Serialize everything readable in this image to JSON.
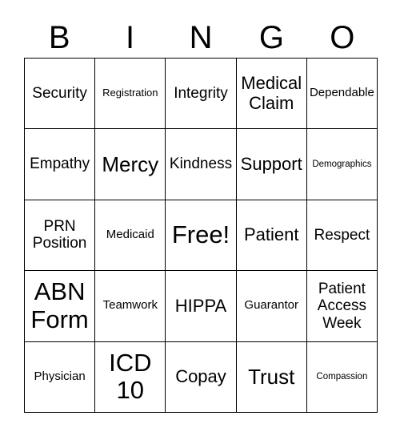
{
  "card": {
    "title_letters": [
      "B",
      "I",
      "N",
      "G",
      "O"
    ],
    "grid": {
      "rows": 5,
      "columns": 5,
      "cells": [
        {
          "text": "Security",
          "size": "md"
        },
        {
          "text": "Registration",
          "size": "xs"
        },
        {
          "text": "Integrity",
          "size": "md"
        },
        {
          "text": "Medical Claim",
          "size": "lg"
        },
        {
          "text": "Dependable",
          "size": "sm"
        },
        {
          "text": "Empathy",
          "size": "md"
        },
        {
          "text": "Mercy",
          "size": "xl"
        },
        {
          "text": "Kindness",
          "size": "md"
        },
        {
          "text": "Support",
          "size": "lg"
        },
        {
          "text": "Demographics",
          "size": "xxs"
        },
        {
          "text": "PRN Position",
          "size": "md"
        },
        {
          "text": "Medicaid",
          "size": "sm"
        },
        {
          "text": "Free!",
          "size": "xxl"
        },
        {
          "text": "Patient",
          "size": "lg"
        },
        {
          "text": "Respect",
          "size": "md"
        },
        {
          "text": "ABN Form",
          "size": "xxl"
        },
        {
          "text": "Teamwork",
          "size": "sm"
        },
        {
          "text": "HIPPA",
          "size": "lg"
        },
        {
          "text": "Guarantor",
          "size": "sm"
        },
        {
          "text": "Patient Access Week",
          "size": "md"
        },
        {
          "text": "Physician",
          "size": "sm"
        },
        {
          "text": "ICD 10",
          "size": "xxl"
        },
        {
          "text": "Copay",
          "size": "lg"
        },
        {
          "text": "Trust",
          "size": "xl"
        },
        {
          "text": "Compassion",
          "size": "xxs"
        }
      ]
    },
    "colors": {
      "background": "#ffffff",
      "text": "#000000",
      "grid_line": "#000000"
    }
  }
}
